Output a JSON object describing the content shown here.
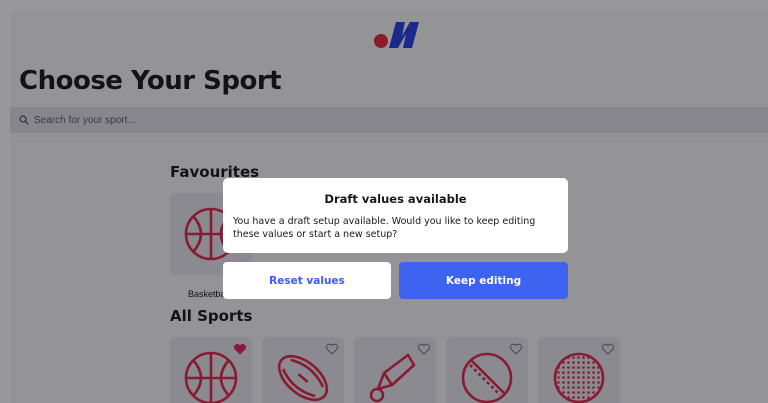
{
  "page": {
    "title": "Choose Your Sport",
    "search_placeholder": "Search for your sport..."
  },
  "brand": {
    "red": "#e3263f",
    "blue": "#2740e0"
  },
  "favourites": {
    "heading": "Favourites",
    "items": [
      {
        "label": "Basketball",
        "icon": "basketball-icon"
      }
    ]
  },
  "all_sports": {
    "heading": "All Sports",
    "items": [
      {
        "icon": "basketball-icon",
        "favourited": true
      },
      {
        "icon": "rugby-ball-icon",
        "favourited": false
      },
      {
        "icon": "shuttlecock-icon",
        "favourited": false
      },
      {
        "icon": "cricket-ball-icon",
        "favourited": false
      },
      {
        "icon": "hockey-ball-icon",
        "favourited": false
      }
    ]
  },
  "modal": {
    "title": "Draft values available",
    "body": "You have a draft setup available. Would you like to keep editing these values or start a new setup?",
    "reset_label": "Reset values",
    "keep_label": "Keep editing"
  },
  "colors": {
    "sport_icon": "#e02748",
    "heart_filled": "#e0245e",
    "primary_button": "#3d63f0"
  }
}
